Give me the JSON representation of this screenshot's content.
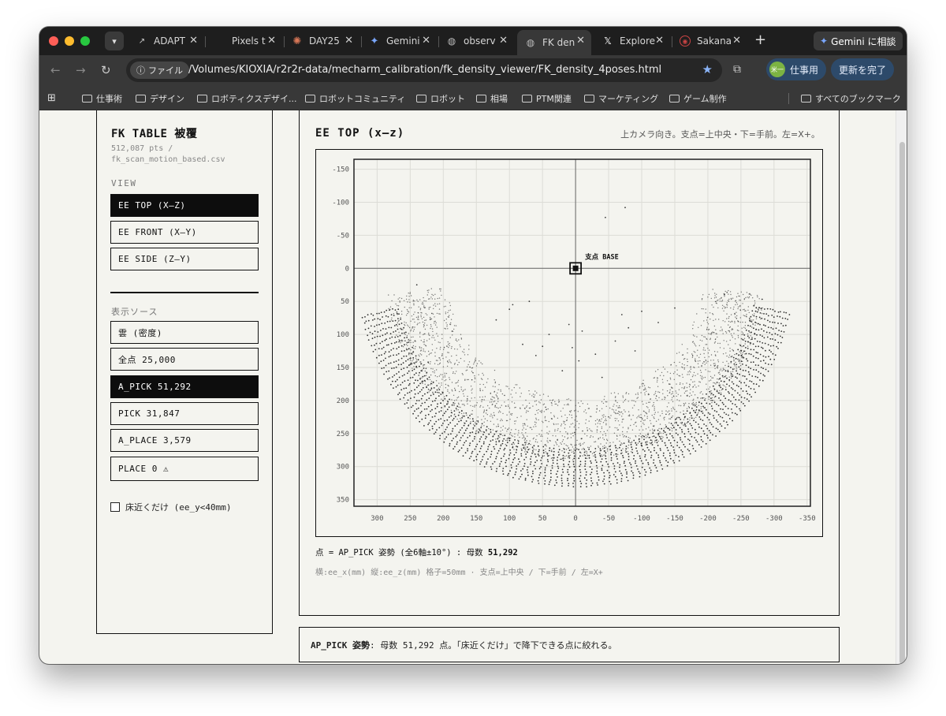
{
  "browser": {
    "tabs": [
      {
        "title": "ADAPT",
        "icon": "adapt-icon"
      },
      {
        "title": "Pixels t",
        "icon": "pixels-icon"
      },
      {
        "title": "DAY25",
        "icon": "claude-icon"
      },
      {
        "title": "Gemini",
        "icon": "gemini-icon"
      },
      {
        "title": "observ",
        "icon": "globe-icon"
      },
      {
        "title": "FK den",
        "icon": "globe-icon",
        "active": true
      },
      {
        "title": "Explore",
        "icon": "x-icon"
      },
      {
        "title": "Sakana",
        "icon": "sakana-icon"
      }
    ],
    "gemini_button": "Gemini に相談",
    "file_chip": "ファイル",
    "url": "/Volumes/KIOXIA/r2r2r-data/mecharm_calibration/fk_density_viewer/FK_density_4poses.html",
    "profile": "仕事用",
    "profile_avatar": "米一",
    "update_button": "更新を完了",
    "bookmarks": [
      "仕事術",
      "デザイン",
      "ロボティクスデザイ...",
      "ロボットコミュニティ",
      "ロボット",
      "相場",
      "PTM関連",
      "マーケティング",
      "ゲーム制作"
    ],
    "all_bookmarks": "すべてのブックマーク"
  },
  "sidebar": {
    "title": "FK TABLE 被覆",
    "subtitle_line1": "512,087 pts /",
    "subtitle_line2": "fk_scan_motion_based.csv",
    "view_label": "VIEW",
    "views": [
      {
        "label": "EE TOP (X–Z)",
        "active": true
      },
      {
        "label": "EE FRONT (X–Y)",
        "active": false
      },
      {
        "label": "EE SIDE (Z–Y)",
        "active": false
      }
    ],
    "source_label": "表示ソース",
    "sources": [
      {
        "label": "雲 (密度)",
        "active": false
      },
      {
        "label": "全点 25,000",
        "active": false
      },
      {
        "label": "A_PICK 51,292",
        "active": true
      },
      {
        "label": "PICK 31,847",
        "active": false
      },
      {
        "label": "A_PLACE 3,579",
        "active": false
      },
      {
        "label": "PLACE 0 ⚠",
        "active": false
      }
    ],
    "floor_checkbox": "床近くだけ (ee_y<40mm)"
  },
  "main": {
    "title": "EE TOP (x–z)",
    "note": "上カメラ向き。支点=上中央・下=手前。左=X+。",
    "caption1_prefix": "点 = AP_PICK 姿勢 (全6軸±10°) : 母数 ",
    "caption1_count": "51,292",
    "caption2": "横:ee_x(mm) 縦:ee_z(mm) 格子=50mm · 支点=上中央 / 下=手前 / 左=X+"
  },
  "note_panel": {
    "bold": "AP_PICK 姿勢",
    "text": " : 母数 51,292 点。「床近くだけ」で降下できる点に絞れる。"
  },
  "chart_data": {
    "type": "scatter",
    "x_ticks": [
      300,
      250,
      200,
      150,
      100,
      50,
      0,
      -50,
      -100,
      -150,
      -200,
      -250,
      -300,
      -350
    ],
    "y_ticks": [
      -150,
      -100,
      -50,
      0,
      50,
      100,
      150,
      200,
      250,
      300,
      350
    ],
    "xlim": [
      335,
      -355
    ],
    "ylim": [
      -165,
      360
    ],
    "x_reversed": true,
    "y_reversed": true,
    "grid_step": 50,
    "grid": true,
    "base_point": {
      "x": 0,
      "z": 0,
      "label": "支点 BASE"
    },
    "arc": {
      "center_x": 0,
      "center_z": 0,
      "inner_radius": 250,
      "outer_radius": 330,
      "start_deg": 12,
      "end_deg": 168
    },
    "outliers": [
      {
        "x": -45,
        "z": -77
      },
      {
        "x": -75,
        "z": -92
      },
      {
        "x": 70,
        "z": 50
      },
      {
        "x": 95,
        "z": 55
      },
      {
        "x": 100,
        "z": 62
      },
      {
        "x": 10,
        "z": 85
      },
      {
        "x": -10,
        "z": 95
      },
      {
        "x": -70,
        "z": 70
      },
      {
        "x": -80,
        "z": 90
      },
      {
        "x": -100,
        "z": 65
      },
      {
        "x": 40,
        "z": 100
      },
      {
        "x": 50,
        "z": 118
      },
      {
        "x": -5,
        "z": 140
      },
      {
        "x": -30,
        "z": 130
      },
      {
        "x": -60,
        "z": 110
      },
      {
        "x": 80,
        "z": 115
      },
      {
        "x": 120,
        "z": 78
      },
      {
        "x": -125,
        "z": 82
      },
      {
        "x": 20,
        "z": 155
      },
      {
        "x": -40,
        "z": 165
      },
      {
        "x": -150,
        "z": 60
      },
      {
        "x": 60,
        "z": 132
      },
      {
        "x": -90,
        "z": 125
      },
      {
        "x": 5,
        "z": 120
      },
      {
        "x": -225,
        "z": 40
      },
      {
        "x": 240,
        "z": 25
      }
    ],
    "point_color": "#111111",
    "marker_color": "#111111",
    "crosshair_color": "#666666"
  }
}
